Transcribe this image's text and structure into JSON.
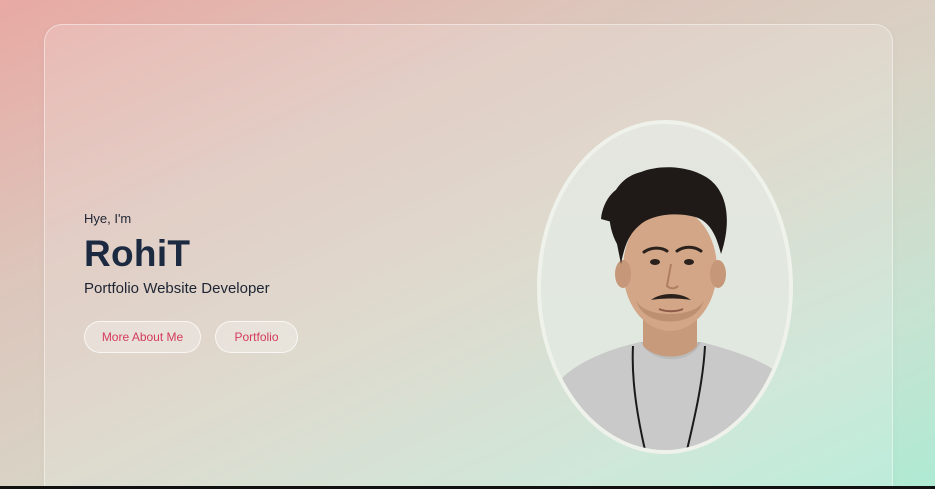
{
  "hero": {
    "greeting": "Hye, I'm",
    "name": "RohiT",
    "role": "Portfolio Website Developer",
    "buttons": {
      "more_label": "More About Me",
      "portfolio_label": "Portfolio"
    }
  },
  "profile": {
    "photo_alt": "RohiT"
  },
  "colors": {
    "accent": "#d43a5c",
    "heading": "#1b2a41"
  }
}
